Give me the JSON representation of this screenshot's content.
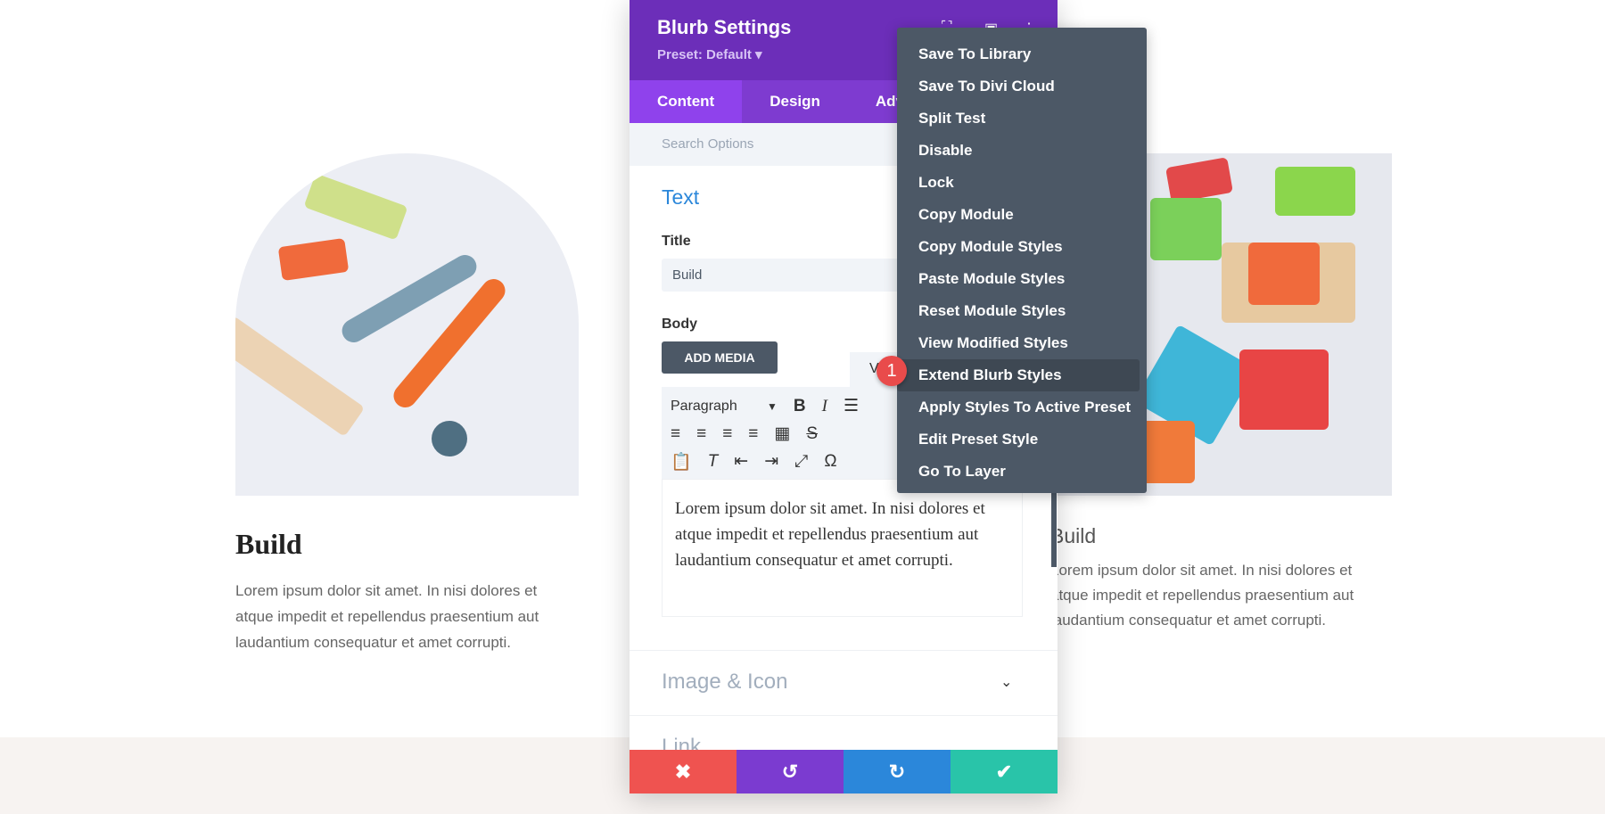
{
  "page": {
    "cards": [
      {
        "title": "Build",
        "body": "Lorem ipsum dolor sit amet. In nisi dolores et atque impedit et repellendus praesentium aut laudantium consequatur et amet corrupti."
      },
      {
        "title": "Build",
        "body": "Lorem ipsum dolor sit amet. In nisi dolores et atque impedit et repellendus praesentium aut laudantium consequatur et amet corrupti."
      }
    ]
  },
  "panel": {
    "title": "Blurb Settings",
    "preset": "Preset: Default ▾",
    "tabs": [
      {
        "label": "Content",
        "active": true
      },
      {
        "label": "Design"
      },
      {
        "label": "Advanced"
      }
    ],
    "tab_visible_label": "Adv",
    "search_placeholder": "Search Options",
    "section_text": "Text",
    "title_label": "Title",
    "title_value": "Build",
    "body_label": "Body",
    "add_media": "ADD MEDIA",
    "visual_tab": "V",
    "format_select": "Paragraph",
    "body_value": "Lorem ipsum dolor sit amet. In nisi dolores et atque impedit et repellendus praesentium aut laudantium consequatur et amet corrupti.",
    "section_image_icon": "Image & Icon",
    "section_link": "Link",
    "colors": {
      "header": "#6c2eb9",
      "tabs": "#7e3bd0",
      "cancel": "#ef5350",
      "undo": "#7b3bd0",
      "redo": "#2b87da",
      "save": "#29c4a9"
    }
  },
  "context_menu": {
    "items": [
      "Save To Library",
      "Save To Divi Cloud",
      "Split Test",
      "Disable",
      "Lock",
      "Copy Module",
      "Copy Module Styles",
      "Paste Module Styles",
      "Reset Module Styles",
      "View Modified Styles",
      "Extend Blurb Styles",
      "Apply Styles To Active Preset",
      "Edit Preset Style",
      "Go To Layer"
    ],
    "highlighted": "Extend Blurb Styles"
  },
  "badge": "1"
}
